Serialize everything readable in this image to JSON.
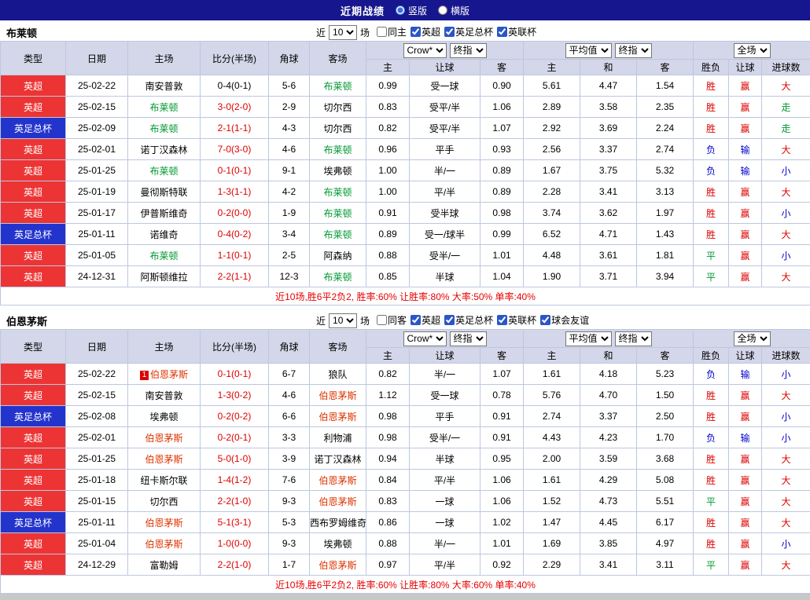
{
  "topbar": {
    "title": "近期战绩",
    "radios": [
      {
        "label": "竖版",
        "selected": true
      },
      {
        "label": "横版",
        "selected": false
      }
    ]
  },
  "filter_labels": {
    "near": "近",
    "matches": "场"
  },
  "table_header": {
    "static": [
      "类型",
      "日期",
      "主场",
      "比分(半场)",
      "角球",
      "客场"
    ],
    "odds_group": [
      "Crow*",
      "终指"
    ],
    "avg_group": [
      "平均值",
      "终指"
    ],
    "result_group": [
      "全场"
    ],
    "sub": [
      "主",
      "让球",
      "客",
      "主",
      "和",
      "客",
      "胜负",
      "让球",
      "进球数"
    ]
  },
  "colors": {
    "red": "#dd0000",
    "blue": "#0000cc",
    "green": "#009933",
    "black": "#000000",
    "focus0": "#009933",
    "focus1": "#dd3300"
  },
  "sections": [
    {
      "team": "布莱顿",
      "team_color_key": "focus0",
      "filters": {
        "count": "10",
        "checkboxes": [
          {
            "label": "同主",
            "checked": false
          },
          {
            "label": "英超",
            "checked": true
          },
          {
            "label": "英足总杯",
            "checked": true
          },
          {
            "label": "英联杯",
            "checked": true
          }
        ]
      },
      "rows": [
        {
          "league": "英超",
          "league_style": "epl",
          "date": "25-02-22",
          "home": "南安普敦",
          "home_focus": false,
          "home_badge": "",
          "score": "0-4(0-1)",
          "score_color": "black",
          "corners": "5-6",
          "away": "布莱顿",
          "away_focus": true,
          "ah": [
            "0.99",
            "受一球",
            "0.90"
          ],
          "eu": [
            "5.61",
            "4.47",
            "1.54"
          ],
          "res": [
            [
              "胜",
              "red"
            ],
            [
              "赢",
              "red"
            ],
            [
              "大",
              "red"
            ]
          ]
        },
        {
          "league": "英超",
          "league_style": "epl",
          "date": "25-02-15",
          "home": "布莱顿",
          "home_focus": true,
          "home_badge": "",
          "score": "3-0(2-0)",
          "score_color": "red",
          "corners": "2-9",
          "away": "切尔西",
          "away_focus": false,
          "ah": [
            "0.83",
            "受平/半",
            "1.06"
          ],
          "eu": [
            "2.89",
            "3.58",
            "2.35"
          ],
          "res": [
            [
              "胜",
              "red"
            ],
            [
              "赢",
              "red"
            ],
            [
              "走",
              "green"
            ]
          ]
        },
        {
          "league": "英足总杯",
          "league_style": "facup",
          "date": "25-02-09",
          "home": "布莱顿",
          "home_focus": true,
          "home_badge": "",
          "score": "2-1(1-1)",
          "score_color": "red",
          "corners": "4-3",
          "away": "切尔西",
          "away_focus": false,
          "ah": [
            "0.82",
            "受平/半",
            "1.07"
          ],
          "eu": [
            "2.92",
            "3.69",
            "2.24"
          ],
          "res": [
            [
              "胜",
              "red"
            ],
            [
              "赢",
              "red"
            ],
            [
              "走",
              "green"
            ]
          ]
        },
        {
          "league": "英超",
          "league_style": "epl",
          "date": "25-02-01",
          "home": "诺丁汉森林",
          "home_focus": false,
          "home_badge": "",
          "score": "7-0(3-0)",
          "score_color": "red",
          "corners": "4-6",
          "away": "布莱顿",
          "away_focus": true,
          "ah": [
            "0.96",
            "平手",
            "0.93"
          ],
          "eu": [
            "2.56",
            "3.37",
            "2.74"
          ],
          "res": [
            [
              "负",
              "blue"
            ],
            [
              "输",
              "blue"
            ],
            [
              "大",
              "red"
            ]
          ]
        },
        {
          "league": "英超",
          "league_style": "epl",
          "date": "25-01-25",
          "home": "布莱顿",
          "home_focus": true,
          "home_badge": "",
          "score": "0-1(0-1)",
          "score_color": "red",
          "corners": "9-1",
          "away": "埃弗顿",
          "away_focus": false,
          "ah": [
            "1.00",
            "半/一",
            "0.89"
          ],
          "eu": [
            "1.67",
            "3.75",
            "5.32"
          ],
          "res": [
            [
              "负",
              "blue"
            ],
            [
              "输",
              "blue"
            ],
            [
              "小",
              "blue"
            ]
          ]
        },
        {
          "league": "英超",
          "league_style": "epl",
          "date": "25-01-19",
          "home": "曼彻斯特联",
          "home_focus": false,
          "home_badge": "",
          "score": "1-3(1-1)",
          "score_color": "red",
          "corners": "4-2",
          "away": "布莱顿",
          "away_focus": true,
          "ah": [
            "1.00",
            "平/半",
            "0.89"
          ],
          "eu": [
            "2.28",
            "3.41",
            "3.13"
          ],
          "res": [
            [
              "胜",
              "red"
            ],
            [
              "赢",
              "red"
            ],
            [
              "大",
              "red"
            ]
          ]
        },
        {
          "league": "英超",
          "league_style": "epl",
          "date": "25-01-17",
          "home": "伊普斯维奇",
          "home_focus": false,
          "home_badge": "",
          "score": "0-2(0-0)",
          "score_color": "red",
          "corners": "1-9",
          "away": "布莱顿",
          "away_focus": true,
          "ah": [
            "0.91",
            "受半球",
            "0.98"
          ],
          "eu": [
            "3.74",
            "3.62",
            "1.97"
          ],
          "res": [
            [
              "胜",
              "red"
            ],
            [
              "赢",
              "red"
            ],
            [
              "小",
              "blue"
            ]
          ]
        },
        {
          "league": "英足总杯",
          "league_style": "facup",
          "date": "25-01-11",
          "home": "诺维奇",
          "home_focus": false,
          "home_badge": "",
          "score": "0-4(0-2)",
          "score_color": "red",
          "corners": "3-4",
          "away": "布莱顿",
          "away_focus": true,
          "ah": [
            "0.89",
            "受一/球半",
            "0.99"
          ],
          "eu": [
            "6.52",
            "4.71",
            "1.43"
          ],
          "res": [
            [
              "胜",
              "red"
            ],
            [
              "赢",
              "red"
            ],
            [
              "大",
              "red"
            ]
          ]
        },
        {
          "league": "英超",
          "league_style": "epl",
          "date": "25-01-05",
          "home": "布莱顿",
          "home_focus": true,
          "home_badge": "",
          "score": "1-1(0-1)",
          "score_color": "red",
          "corners": "2-5",
          "away": "阿森纳",
          "away_focus": false,
          "ah": [
            "0.88",
            "受半/一",
            "1.01"
          ],
          "eu": [
            "4.48",
            "3.61",
            "1.81"
          ],
          "res": [
            [
              "平",
              "green"
            ],
            [
              "赢",
              "red"
            ],
            [
              "小",
              "blue"
            ]
          ]
        },
        {
          "league": "英超",
          "league_style": "epl",
          "date": "24-12-31",
          "home": "阿斯顿维拉",
          "home_focus": false,
          "home_badge": "",
          "score": "2-2(1-1)",
          "score_color": "red",
          "corners": "12-3",
          "away": "布莱顿",
          "away_focus": true,
          "ah": [
            "0.85",
            "半球",
            "1.04"
          ],
          "eu": [
            "1.90",
            "3.71",
            "3.94"
          ],
          "res": [
            [
              "平",
              "green"
            ],
            [
              "赢",
              "red"
            ],
            [
              "大",
              "red"
            ]
          ]
        }
      ],
      "summary": "近10场,胜6平2负2, 胜率:60% 让胜率:80% 大率:50% 单率:40%"
    },
    {
      "team": "伯恩茅斯",
      "team_color_key": "focus1",
      "filters": {
        "count": "10",
        "checkboxes": [
          {
            "label": "同客",
            "checked": false
          },
          {
            "label": "英超",
            "checked": true
          },
          {
            "label": "英足总杯",
            "checked": true
          },
          {
            "label": "英联杯",
            "checked": true
          },
          {
            "label": "球会友谊",
            "checked": true
          }
        ]
      },
      "rows": [
        {
          "league": "英超",
          "league_style": "epl",
          "date": "25-02-22",
          "home": "伯恩茅斯",
          "home_focus": true,
          "home_badge": "1",
          "score": "0-1(0-1)",
          "score_color": "red",
          "corners": "6-7",
          "away": "狼队",
          "away_focus": false,
          "ah": [
            "0.82",
            "半/一",
            "1.07"
          ],
          "eu": [
            "1.61",
            "4.18",
            "5.23"
          ],
          "res": [
            [
              "负",
              "blue"
            ],
            [
              "输",
              "blue"
            ],
            [
              "小",
              "blue"
            ]
          ]
        },
        {
          "league": "英超",
          "league_style": "epl",
          "date": "25-02-15",
          "home": "南安普敦",
          "home_focus": false,
          "home_badge": "",
          "score": "1-3(0-2)",
          "score_color": "red",
          "corners": "4-6",
          "away": "伯恩茅斯",
          "away_focus": true,
          "ah": [
            "1.12",
            "受一球",
            "0.78"
          ],
          "eu": [
            "5.76",
            "4.70",
            "1.50"
          ],
          "res": [
            [
              "胜",
              "red"
            ],
            [
              "赢",
              "red"
            ],
            [
              "大",
              "red"
            ]
          ]
        },
        {
          "league": "英足总杯",
          "league_style": "facup",
          "date": "25-02-08",
          "home": "埃弗顿",
          "home_focus": false,
          "home_badge": "",
          "score": "0-2(0-2)",
          "score_color": "red",
          "corners": "6-6",
          "away": "伯恩茅斯",
          "away_focus": true,
          "ah": [
            "0.98",
            "平手",
            "0.91"
          ],
          "eu": [
            "2.74",
            "3.37",
            "2.50"
          ],
          "res": [
            [
              "胜",
              "red"
            ],
            [
              "赢",
              "red"
            ],
            [
              "小",
              "blue"
            ]
          ]
        },
        {
          "league": "英超",
          "league_style": "epl",
          "date": "25-02-01",
          "home": "伯恩茅斯",
          "home_focus": true,
          "home_badge": "",
          "score": "0-2(0-1)",
          "score_color": "red",
          "corners": "3-3",
          "away": "利物浦",
          "away_focus": false,
          "ah": [
            "0.98",
            "受半/一",
            "0.91"
          ],
          "eu": [
            "4.43",
            "4.23",
            "1.70"
          ],
          "res": [
            [
              "负",
              "blue"
            ],
            [
              "输",
              "blue"
            ],
            [
              "小",
              "blue"
            ]
          ]
        },
        {
          "league": "英超",
          "league_style": "epl",
          "date": "25-01-25",
          "home": "伯恩茅斯",
          "home_focus": true,
          "home_badge": "",
          "score": "5-0(1-0)",
          "score_color": "red",
          "corners": "3-9",
          "away": "诺丁汉森林",
          "away_focus": false,
          "ah": [
            "0.94",
            "半球",
            "0.95"
          ],
          "eu": [
            "2.00",
            "3.59",
            "3.68"
          ],
          "res": [
            [
              "胜",
              "red"
            ],
            [
              "赢",
              "red"
            ],
            [
              "大",
              "red"
            ]
          ]
        },
        {
          "league": "英超",
          "league_style": "epl",
          "date": "25-01-18",
          "home": "纽卡斯尔联",
          "home_focus": false,
          "home_badge": "",
          "score": "1-4(1-2)",
          "score_color": "red",
          "corners": "7-6",
          "away": "伯恩茅斯",
          "away_focus": true,
          "ah": [
            "0.84",
            "平/半",
            "1.06"
          ],
          "eu": [
            "1.61",
            "4.29",
            "5.08"
          ],
          "res": [
            [
              "胜",
              "red"
            ],
            [
              "赢",
              "red"
            ],
            [
              "大",
              "red"
            ]
          ]
        },
        {
          "league": "英超",
          "league_style": "epl",
          "date": "25-01-15",
          "home": "切尔西",
          "home_focus": false,
          "home_badge": "",
          "score": "2-2(1-0)",
          "score_color": "red",
          "corners": "9-3",
          "away": "伯恩茅斯",
          "away_focus": true,
          "ah": [
            "0.83",
            "一球",
            "1.06"
          ],
          "eu": [
            "1.52",
            "4.73",
            "5.51"
          ],
          "res": [
            [
              "平",
              "green"
            ],
            [
              "赢",
              "red"
            ],
            [
              "大",
              "red"
            ]
          ]
        },
        {
          "league": "英足总杯",
          "league_style": "facup",
          "date": "25-01-11",
          "home": "伯恩茅斯",
          "home_focus": true,
          "home_badge": "",
          "score": "5-1(3-1)",
          "score_color": "red",
          "corners": "5-3",
          "away": "西布罗姆维奇",
          "away_focus": false,
          "ah": [
            "0.86",
            "一球",
            "1.02"
          ],
          "eu": [
            "1.47",
            "4.45",
            "6.17"
          ],
          "res": [
            [
              "胜",
              "red"
            ],
            [
              "赢",
              "red"
            ],
            [
              "大",
              "red"
            ]
          ]
        },
        {
          "league": "英超",
          "league_style": "epl",
          "date": "25-01-04",
          "home": "伯恩茅斯",
          "home_focus": true,
          "home_badge": "",
          "score": "1-0(0-0)",
          "score_color": "red",
          "corners": "9-3",
          "away": "埃弗顿",
          "away_focus": false,
          "ah": [
            "0.88",
            "半/一",
            "1.01"
          ],
          "eu": [
            "1.69",
            "3.85",
            "4.97"
          ],
          "res": [
            [
              "胜",
              "red"
            ],
            [
              "赢",
              "red"
            ],
            [
              "小",
              "blue"
            ]
          ]
        },
        {
          "league": "英超",
          "league_style": "epl",
          "date": "24-12-29",
          "home": "富勒姆",
          "home_focus": false,
          "home_badge": "",
          "score": "2-2(1-0)",
          "score_color": "red",
          "corners": "1-7",
          "away": "伯恩茅斯",
          "away_focus": true,
          "ah": [
            "0.97",
            "平/半",
            "0.92"
          ],
          "eu": [
            "2.29",
            "3.41",
            "3.11"
          ],
          "res": [
            [
              "平",
              "green"
            ],
            [
              "赢",
              "red"
            ],
            [
              "大",
              "red"
            ]
          ]
        }
      ],
      "summary": "近10场,胜6平2负2, 胜率:60% 让胜率:80% 大率:60% 单率:40%"
    }
  ]
}
